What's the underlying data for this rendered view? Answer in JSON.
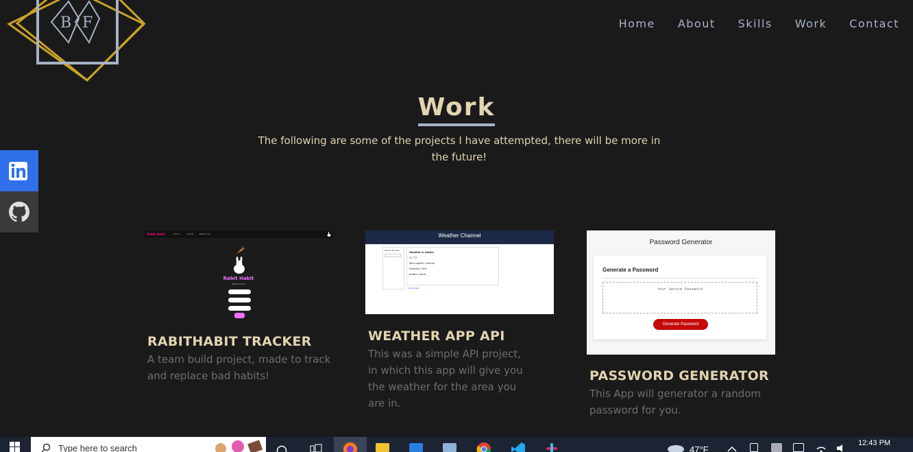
{
  "nav": {
    "items": [
      "Home",
      "About",
      "Skills",
      "Work",
      "Contact"
    ]
  },
  "logo": {
    "icon": "bf-monogram-logo",
    "letters": "BF"
  },
  "work": {
    "title": "Work",
    "intro": "The following are some of the projects I have attempted, there will be more in the future!"
  },
  "social": {
    "linkedin_icon": "linkedin-icon",
    "github_icon": "github-icon",
    "linkedin_color": "#2f6fe9"
  },
  "projects": [
    {
      "title": "RABITHABIT TRACKER",
      "description": "A team build project, made to track and replace bad habits!",
      "preview": {
        "brand": "Rabit Habit",
        "nav": [
          "Home",
          "About",
          "Resources"
        ],
        "app_title": "Rabit Habit",
        "subtitle": "Habit tracker"
      }
    },
    {
      "title": "WEATHER APP API",
      "description": "This was a simple API project, in which this app will give you the weather for the area you are in.",
      "preview": {
        "header": "Weather Channel",
        "search_label": "Search By City",
        "city_heading": "Weather in Alaska",
        "lines": [
          "47.7°F",
          "Wind speed: 1.6km/h",
          "Humidity: 59%",
          "broken clouds"
        ],
        "link": "Anchorage"
      }
    },
    {
      "title": "PASSWORD GENERATOR",
      "description": "This App will generator a random password for you.",
      "preview": {
        "header": "Password Generator",
        "box_title": "Generate a Password",
        "placeholder": "Your Secure Password",
        "button": "Generate Password"
      }
    }
  ],
  "taskbar": {
    "search_placeholder": "Type here to search",
    "temperature": "47°F",
    "time": "12:43 PM"
  },
  "colors": {
    "background": "#1a1a1b",
    "accent_gold": "#c9a227",
    "accent_steel": "#a7b3c6",
    "heading_beige": "#e2d4b0"
  }
}
